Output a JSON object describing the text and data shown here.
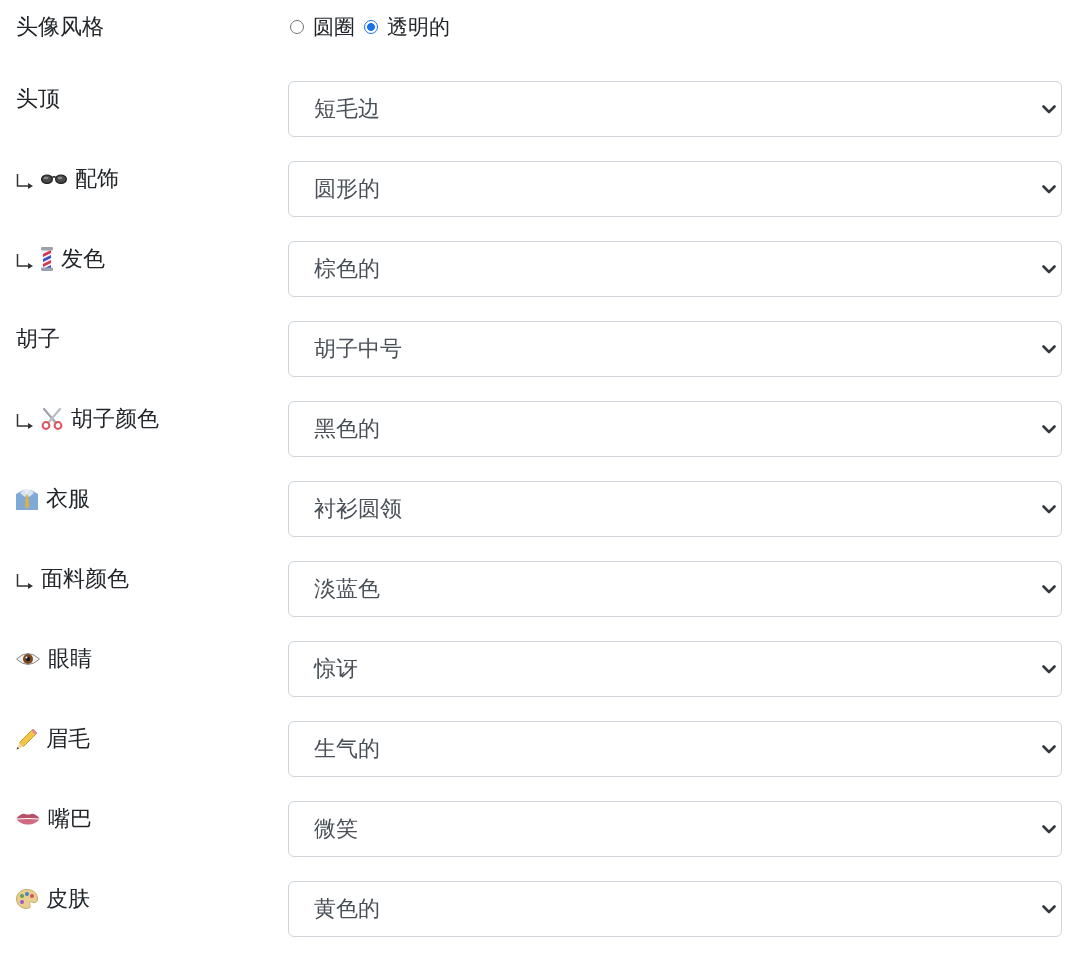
{
  "avatar_style": {
    "label": "头像风格",
    "options": [
      {
        "label": "圆圈",
        "selected": false
      },
      {
        "label": "透明的",
        "selected": true
      }
    ]
  },
  "options": [
    {
      "kind": "plain",
      "label": "头顶",
      "value": "短毛边",
      "children": [
        {
          "kind": "glasses",
          "label": "配饰",
          "value": "圆形的"
        },
        {
          "kind": "barber_pole",
          "label": "发色",
          "value": "棕色的"
        }
      ]
    },
    {
      "kind": "plain",
      "label": "胡子",
      "value": "胡子中号",
      "children": [
        {
          "kind": "scissors",
          "label": "胡子颜色",
          "value": "黑色的"
        }
      ]
    },
    {
      "kind": "shirt",
      "label": "衣服",
      "value": "衬衫圆领",
      "children": [
        {
          "kind": "plain",
          "label": "面料颜色",
          "value": "淡蓝色"
        }
      ]
    },
    {
      "kind": "eye",
      "label": "眼睛",
      "value": "惊讶"
    },
    {
      "kind": "pencil",
      "label": "眉毛",
      "value": "生气的"
    },
    {
      "kind": "lips",
      "label": "嘴巴",
      "value": "微笑"
    },
    {
      "kind": "palette",
      "label": "皮肤",
      "value": "黄色的"
    }
  ]
}
